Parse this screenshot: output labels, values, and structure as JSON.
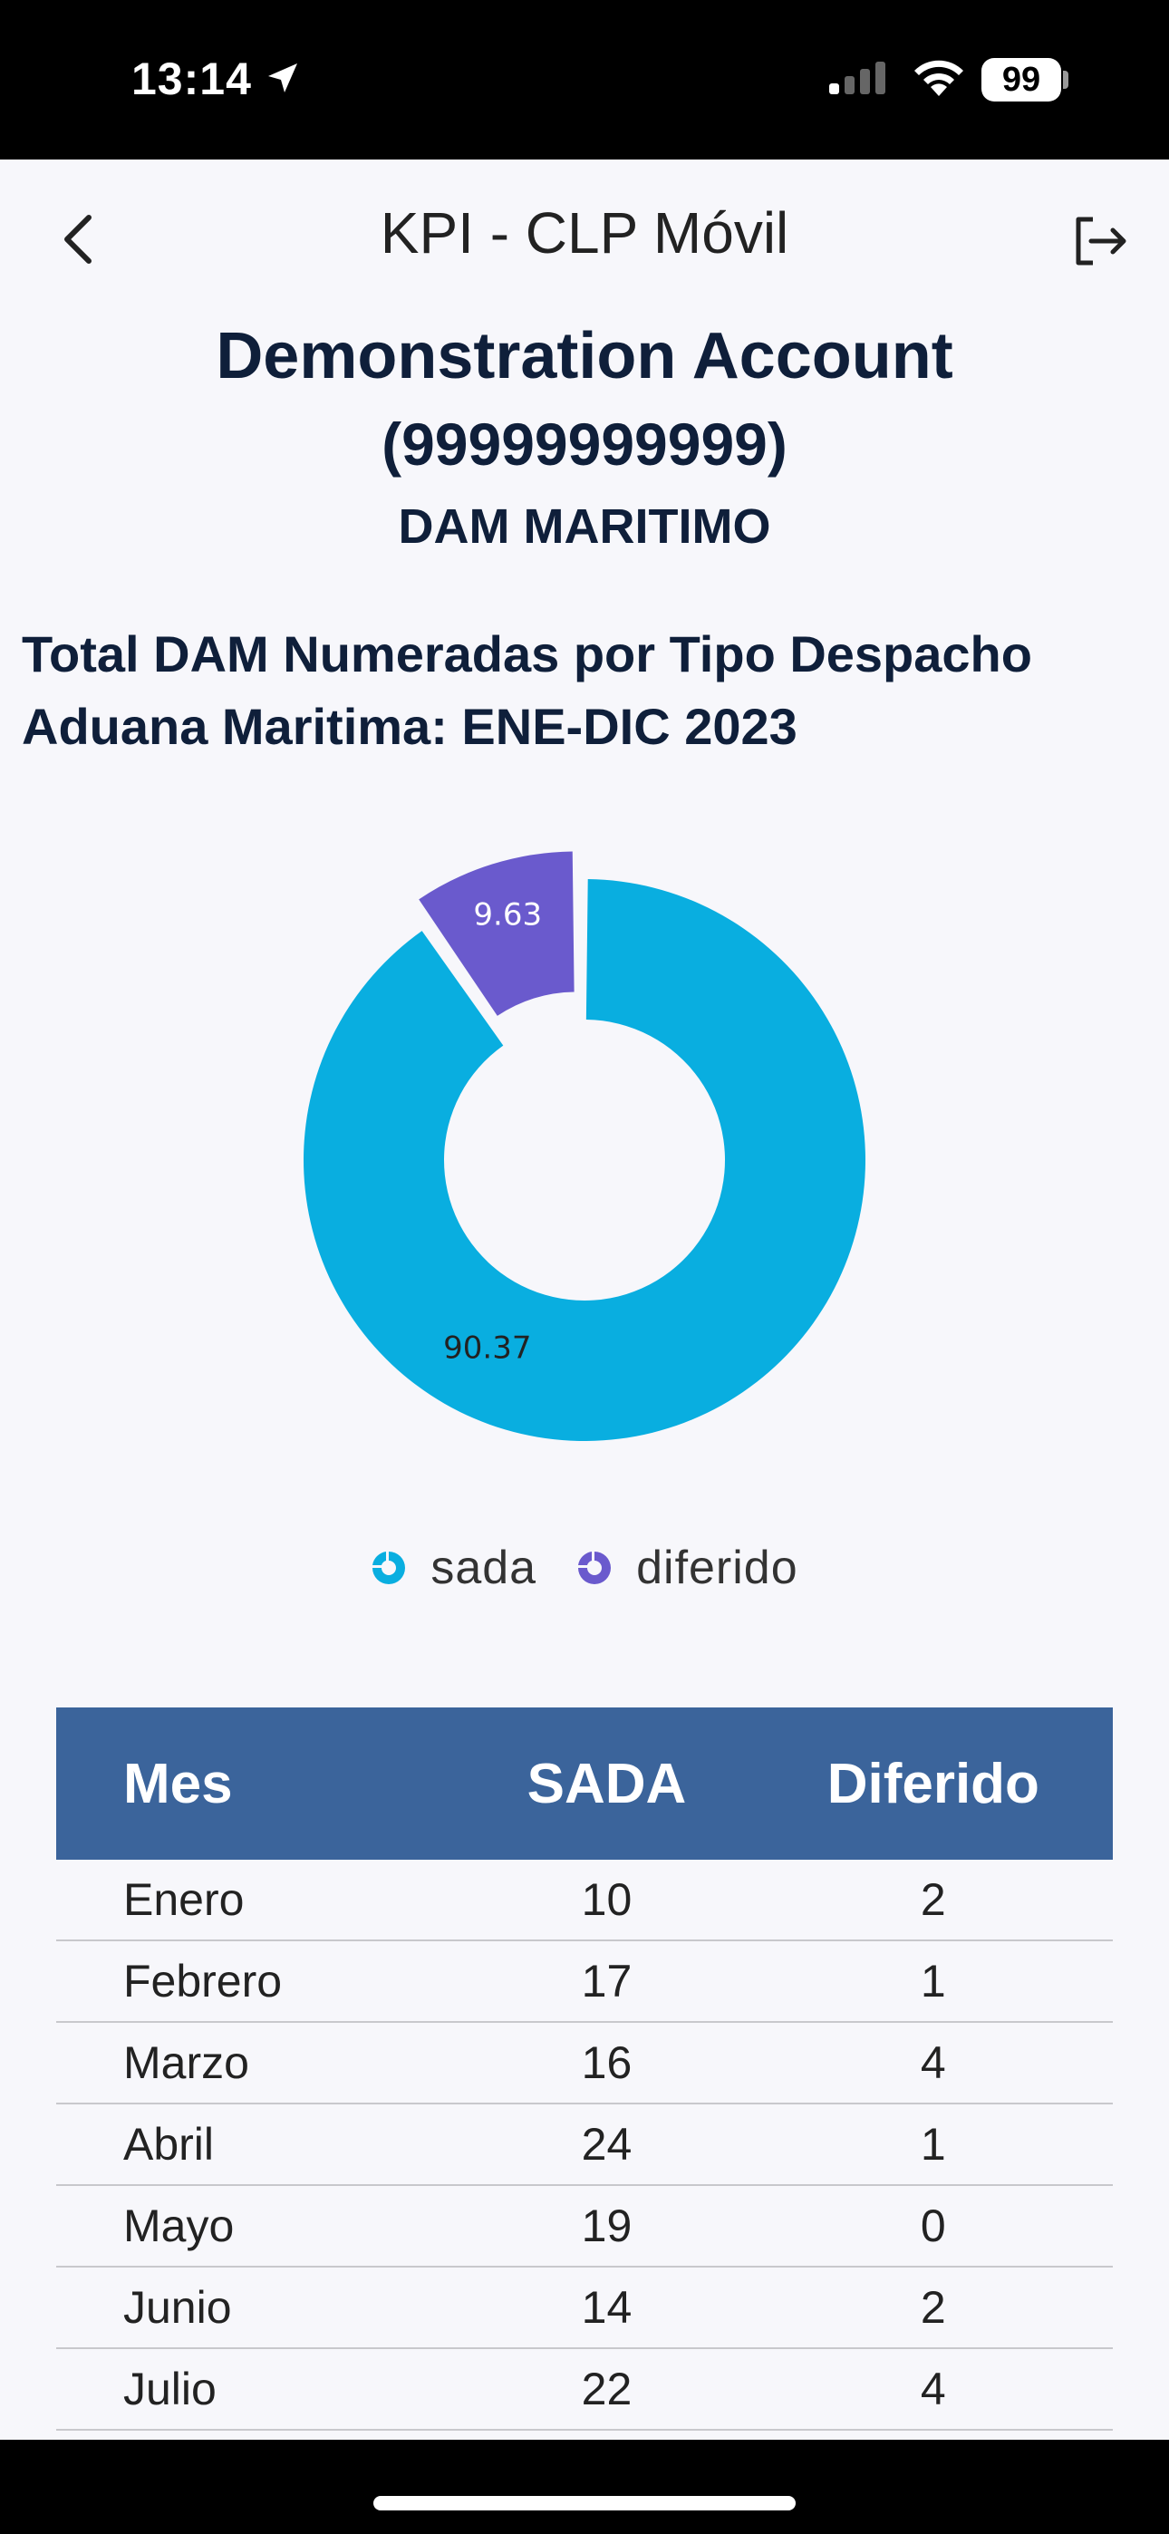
{
  "status_bar": {
    "time": "13:14",
    "battery": "99"
  },
  "nav": {
    "title": "KPI - CLP Móvil"
  },
  "account": {
    "name": "Demonstration Account",
    "id": "(99999999999)",
    "module": "DAM MARITIMO"
  },
  "chart_data": {
    "type": "pie",
    "title_line1": "Total DAM Numeradas por Tipo Despacho",
    "title_line2": "Aduana Maritima: ENE-DIC 2023",
    "categories": [
      "sada",
      "diferido"
    ],
    "values": [
      90.37,
      9.63
    ],
    "colors": [
      "#09aee0",
      "#6a5acd"
    ],
    "legend": "bottom"
  },
  "table": {
    "headers": {
      "mes": "Mes",
      "sada": "SADA",
      "diferido": "Diferido"
    },
    "rows": [
      {
        "mes": "Enero",
        "sada": "10",
        "diferido": "2"
      },
      {
        "mes": "Febrero",
        "sada": "17",
        "diferido": "1"
      },
      {
        "mes": "Marzo",
        "sada": "16",
        "diferido": "4"
      },
      {
        "mes": "Abril",
        "sada": "24",
        "diferido": "1"
      },
      {
        "mes": "Mayo",
        "sada": "19",
        "diferido": "0"
      },
      {
        "mes": "Junio",
        "sada": "14",
        "diferido": "2"
      },
      {
        "mes": "Julio",
        "sada": "22",
        "diferido": "4"
      }
    ]
  },
  "icons": {
    "back": "chevron-left-icon",
    "logout": "logout-icon",
    "location": "location-arrow-icon",
    "signal": "cellular-signal-icon",
    "wifi": "wifi-icon"
  }
}
